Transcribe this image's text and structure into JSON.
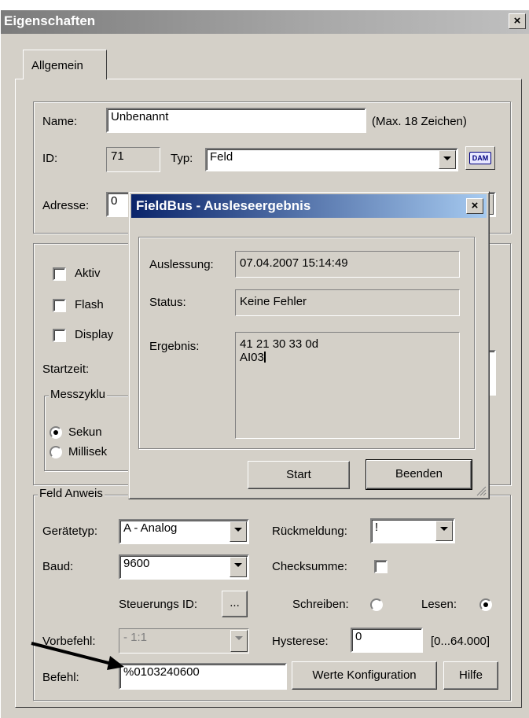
{
  "window": {
    "title": "Eigenschaften",
    "close": "×"
  },
  "tab": {
    "label": "Allgemein"
  },
  "name": {
    "label": "Name:",
    "value": "Unbenannt",
    "hint": "(Max. 18 Zeichen)"
  },
  "id": {
    "label": "ID:",
    "value": "71"
  },
  "typ": {
    "label": "Typ:",
    "value": "Feld",
    "icon": "DAM"
  },
  "adresse": {
    "label": "Adresse:",
    "value": "0"
  },
  "checks": {
    "aktiv": "Aktiv",
    "flash": "Flash",
    "display": "Display"
  },
  "startzeit": {
    "label": "Startzeit:"
  },
  "messzyklus": {
    "legend": "Messzyklu",
    "sekunden": "Sekun",
    "millisek": "Millisek"
  },
  "feld": {
    "legend": "Feld Anweis",
    "geraetetyp_label": "Gerätetyp:",
    "geraetetyp_value": "A - Analog",
    "rueckmeldung_label": "Rückmeldung:",
    "rueckmeldung_value": "!",
    "baud_label": "Baud:",
    "baud_value": "9600",
    "checksumme_label": "Checksumme:",
    "steuerungs_label": "Steuerungs ID:",
    "steuerungs_btn": "...",
    "schreiben_label": "Schreiben:",
    "lesen_label": "Lesen:",
    "vorbefehl_label": "Vorbefehl:",
    "vorbefehl_value": "- 1:1",
    "hysterese_label": "Hysterese:",
    "hysterese_value": "0",
    "hysterese_range": "[0...64.000]",
    "befehl_label": "Befehl:",
    "befehl_value": "%0103240600",
    "werte_btn": "Werte Konfiguration",
    "hilfe_btn": "Hilfe"
  },
  "fieldbus": {
    "title": "FieldBus - Ausleseergebnis",
    "close": "×",
    "auslesung_label": "Auslessung:",
    "auslesung_value": "07.04.2007 15:14:49",
    "status_label": "Status:",
    "status_value": "Keine Fehler",
    "ergebnis_label": "Ergebnis:",
    "ergebnis_line1": "41 21 30 33 0d",
    "ergebnis_line2": "AI03",
    "start_btn": "Start",
    "beenden_btn": "Beenden"
  }
}
